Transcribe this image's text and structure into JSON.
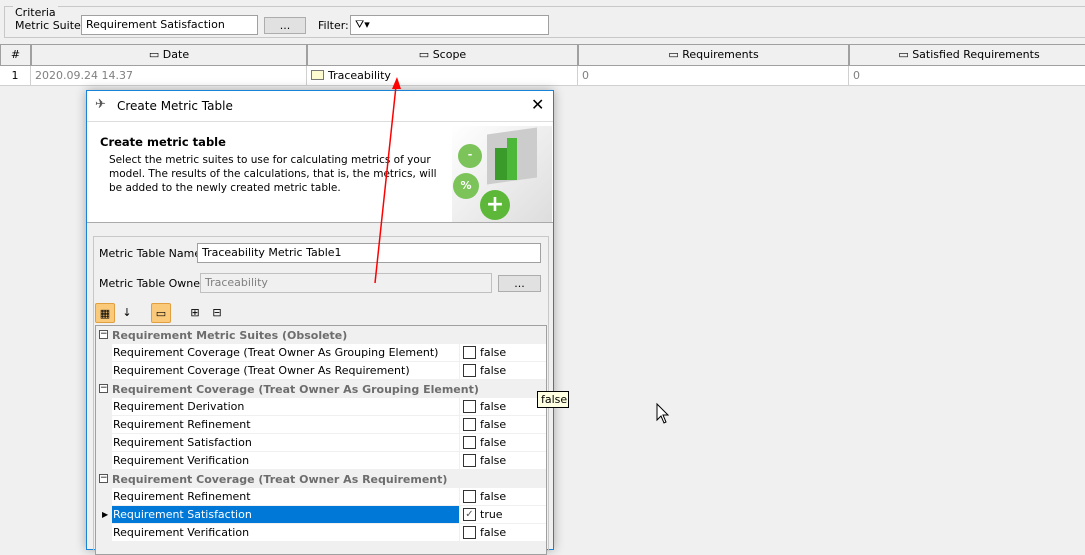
{
  "criteria": {
    "legend": "Criteria",
    "metric_suite_label": "Metric Suite:",
    "metric_suite_value": "Requirement Satisfaction",
    "browse_label": "...",
    "filter_label": "Filter:"
  },
  "table": {
    "columns": [
      "#",
      "Date",
      "Scope",
      "Requirements",
      "Satisfied Requirements"
    ],
    "rows": [
      {
        "num": "1",
        "date": "2020.09.24 14.37",
        "scope": "Traceability",
        "requirements": "0",
        "satisfied": "0"
      }
    ]
  },
  "dialog": {
    "title": "Create Metric Table",
    "heading": "Create metric table",
    "description": "Select the metric suites to use for calculating metrics of your model. The results of the calculations, that is, the metrics, will be added to the newly created metric table.",
    "name_label": "Metric Table Name:",
    "name_value": "Traceability Metric Table1",
    "owner_label": "Metric Table Owner:",
    "owner_value": "Traceability",
    "browse_label": "...",
    "groups": [
      {
        "label": "Requirement Metric Suites (Obsolete)",
        "items": [
          {
            "label": "Requirement Coverage (Treat Owner As Grouping Element)",
            "value": "false"
          },
          {
            "label": "Requirement Coverage (Treat Owner As Requirement)",
            "value": "false"
          }
        ]
      },
      {
        "label": "Requirement Coverage (Treat Owner As Grouping Element)",
        "items": [
          {
            "label": "Requirement Derivation",
            "value": "false"
          },
          {
            "label": "Requirement Refinement",
            "value": "false"
          },
          {
            "label": "Requirement Satisfaction",
            "value": "false"
          },
          {
            "label": "Requirement Verification",
            "value": "false"
          }
        ]
      },
      {
        "label": "Requirement Coverage (Treat Owner As Requirement)",
        "items": [
          {
            "label": "Requirement Refinement",
            "value": "false"
          },
          {
            "label": "Requirement Satisfaction",
            "value": "true",
            "selected": true
          },
          {
            "label": "Requirement Verification",
            "value": "false"
          }
        ]
      }
    ]
  },
  "tooltip": "false",
  "colors": {
    "selection": "#0078d7",
    "annotation_arrow": "#ff0000"
  }
}
